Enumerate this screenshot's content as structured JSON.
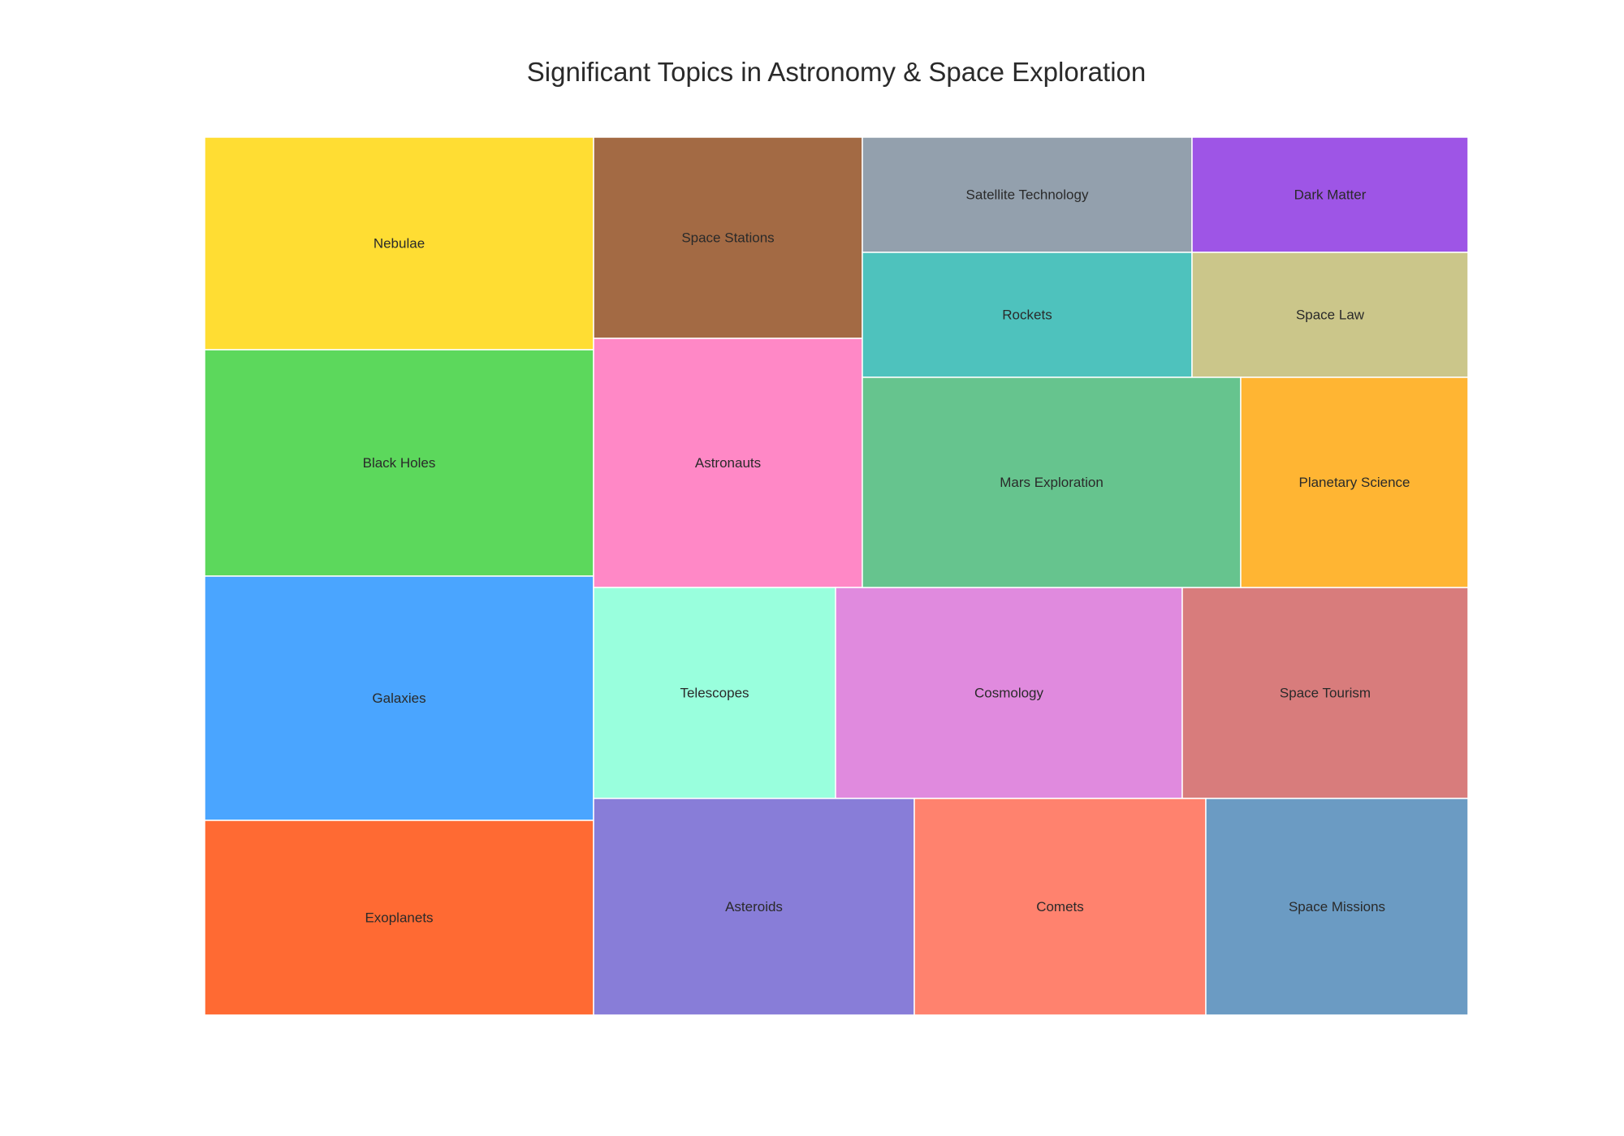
{
  "chart_data": {
    "type": "treemap",
    "title": "Significant Topics in Astronomy & Space Exploration",
    "items": [
      {
        "label": "Nebulae",
        "color": "#FFDD33"
      },
      {
        "label": "Black Holes",
        "color": "#5CD85C"
      },
      {
        "label": "Galaxies",
        "color": "#4AA5FF"
      },
      {
        "label": "Exoplanets",
        "color": "#FF6A33"
      },
      {
        "label": "Space Stations",
        "color": "#A36A44"
      },
      {
        "label": "Astronauts",
        "color": "#FF88C6"
      },
      {
        "label": "Telescopes",
        "color": "#99FFDD"
      },
      {
        "label": "Cosmology",
        "color": "#E08ADE"
      },
      {
        "label": "Space Tourism",
        "color": "#D87C7C"
      },
      {
        "label": "Asteroids",
        "color": "#887DD8"
      },
      {
        "label": "Comets",
        "color": "#FF826E"
      },
      {
        "label": "Space Missions",
        "color": "#6B9BC3"
      },
      {
        "label": "Satellite Technology",
        "color": "#93A0AD"
      },
      {
        "label": "Dark Matter",
        "color": "#9E55E6"
      },
      {
        "label": "Rockets",
        "color": "#4EC2BD"
      },
      {
        "label": "Space Law",
        "color": "#CBC68A"
      },
      {
        "label": "Mars Exploration",
        "color": "#66C48E"
      },
      {
        "label": "Planetary Science",
        "color": "#FFB533"
      }
    ]
  }
}
